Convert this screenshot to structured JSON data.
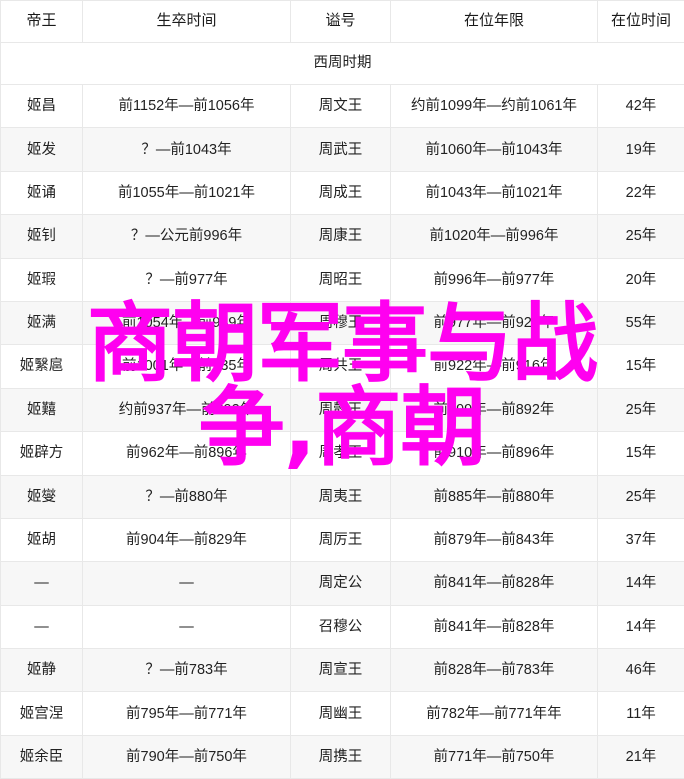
{
  "table": {
    "headers": [
      "帝王",
      "生卒时间",
      "谥号",
      "在位年限",
      "在位时间"
    ],
    "section_label": "西周时期",
    "rows": [
      {
        "name": "姬昌",
        "life": "前1152年—前1056年",
        "posthumous": "周文王",
        "reign": "约前1099年—约前1061年",
        "years": "42年"
      },
      {
        "name": "姬发",
        "life": "？—前1043年",
        "posthumous": "周武王",
        "reign": "前1060年—前1043年",
        "years": "19年"
      },
      {
        "name": "姬诵",
        "life": "前1055年—前1021年",
        "posthumous": "周成王",
        "reign": "前1043年—前1021年",
        "years": "22年"
      },
      {
        "name": "姬钊",
        "life": "？—公元前996年",
        "posthumous": "周康王",
        "reign": "前1020年—前996年",
        "years": "25年"
      },
      {
        "name": "姬瑕",
        "life": "？—前977年",
        "posthumous": "周昭王",
        "reign": "前996年—前977年",
        "years": "20年"
      },
      {
        "name": "姬满",
        "life": "前1054年—前949年",
        "posthumous": "周穆王",
        "reign": "前977年—前922年",
        "years": "55年"
      },
      {
        "name": "姬繄扈",
        "life": "前1001年—前935年",
        "posthumous": "周共王",
        "reign": "前922年—前916年",
        "years": "15年"
      },
      {
        "name": "姬囏",
        "life": "约前937年—前892年",
        "posthumous": "周懿王",
        "reign": "前899年—前892年",
        "years": "25年"
      },
      {
        "name": "姬辟方",
        "life": "前962年—前896年",
        "posthumous": "周孝王",
        "reign": "前910年—前896年",
        "years": "15年"
      },
      {
        "name": "姬燮",
        "life": "？—前880年",
        "posthumous": "周夷王",
        "reign": "前885年—前880年",
        "years": "25年"
      },
      {
        "name": "姬胡",
        "life": "前904年—前829年",
        "posthumous": "周厉王",
        "reign": "前879年—前843年",
        "years": "37年"
      },
      {
        "name": "—",
        "life": "—",
        "posthumous": "周定公",
        "reign": "前841年—前828年",
        "years": "14年"
      },
      {
        "name": "—",
        "life": "—",
        "posthumous": "召穆公",
        "reign": "前841年—前828年",
        "years": "14年"
      },
      {
        "name": "姬静",
        "life": "？—前783年",
        "posthumous": "周宣王",
        "reign": "前828年—前783年",
        "years": "46年"
      },
      {
        "name": "姬宫涅",
        "life": "前795年—前771年",
        "posthumous": "周幽王",
        "reign": "前782年—前771年年",
        "years": "11年"
      },
      {
        "name": "姬余臣",
        "life": "前790年—前750年",
        "posthumous": "周携王",
        "reign": "前771年—前750年",
        "years": "21年"
      }
    ]
  },
  "watermark": {
    "line1": "商朝军事与战",
    "line2": "争,商朝",
    "color": "#ff00f0"
  }
}
